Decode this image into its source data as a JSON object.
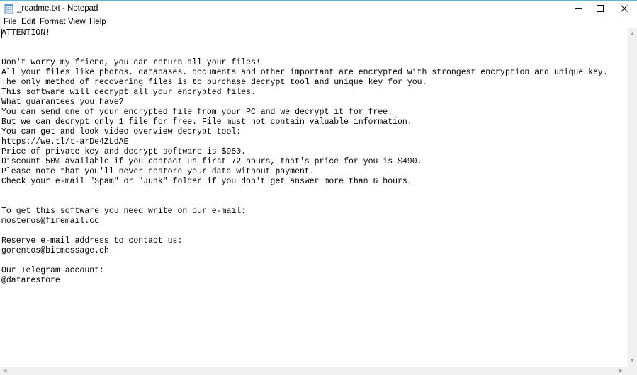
{
  "window": {
    "title": "_readme.txt - Notepad",
    "icon": "notepad-icon",
    "controls": {
      "minimize_icon": "minimize-icon",
      "maximize_icon": "maximize-icon",
      "close_icon": "close-icon"
    }
  },
  "menu": {
    "file": "File",
    "edit": "Edit",
    "format": "Format",
    "view": "View",
    "help": "Help"
  },
  "document": {
    "text": "ATTENTION!\n\n\nDon't worry my friend, you can return all your files!\nAll your files like photos, databases, documents and other important are encrypted with strongest encryption and unique key.\nThe only method of recovering files is to purchase decrypt tool and unique key for you.\nThis software will decrypt all your encrypted files.\nWhat guarantees you have?\nYou can send one of your encrypted file from your PC and we decrypt it for free.\nBut we can decrypt only 1 file for free. File must not contain valuable information.\nYou can get and look video overview decrypt tool:\nhttps://we.tl/t-arDe4ZLdAE\nPrice of private key and decrypt software is $980.\nDiscount 50% available if you contact us first 72 hours, that's price for you is $490.\nPlease note that you'll never restore your data without payment.\nCheck your e-mail \"Spam\" or \"Junk\" folder if you don't get answer more than 6 hours.\n\n\nTo get this software you need write on our e-mail:\nmosteros@firemail.cc\n\nReserve e-mail address to contact us:\ngorentos@bitmessage.ch\n\nOur Telegram account:\n@datarestore"
  },
  "scrollbars": {
    "up_icon": "scroll-up-icon",
    "down_icon": "scroll-down-icon",
    "left_icon": "scroll-left-icon",
    "right_icon": "scroll-right-icon"
  },
  "colors": {
    "window_border": "#5fb8d6",
    "scrollbar_track": "#f0f0f0",
    "text": "#000000"
  }
}
